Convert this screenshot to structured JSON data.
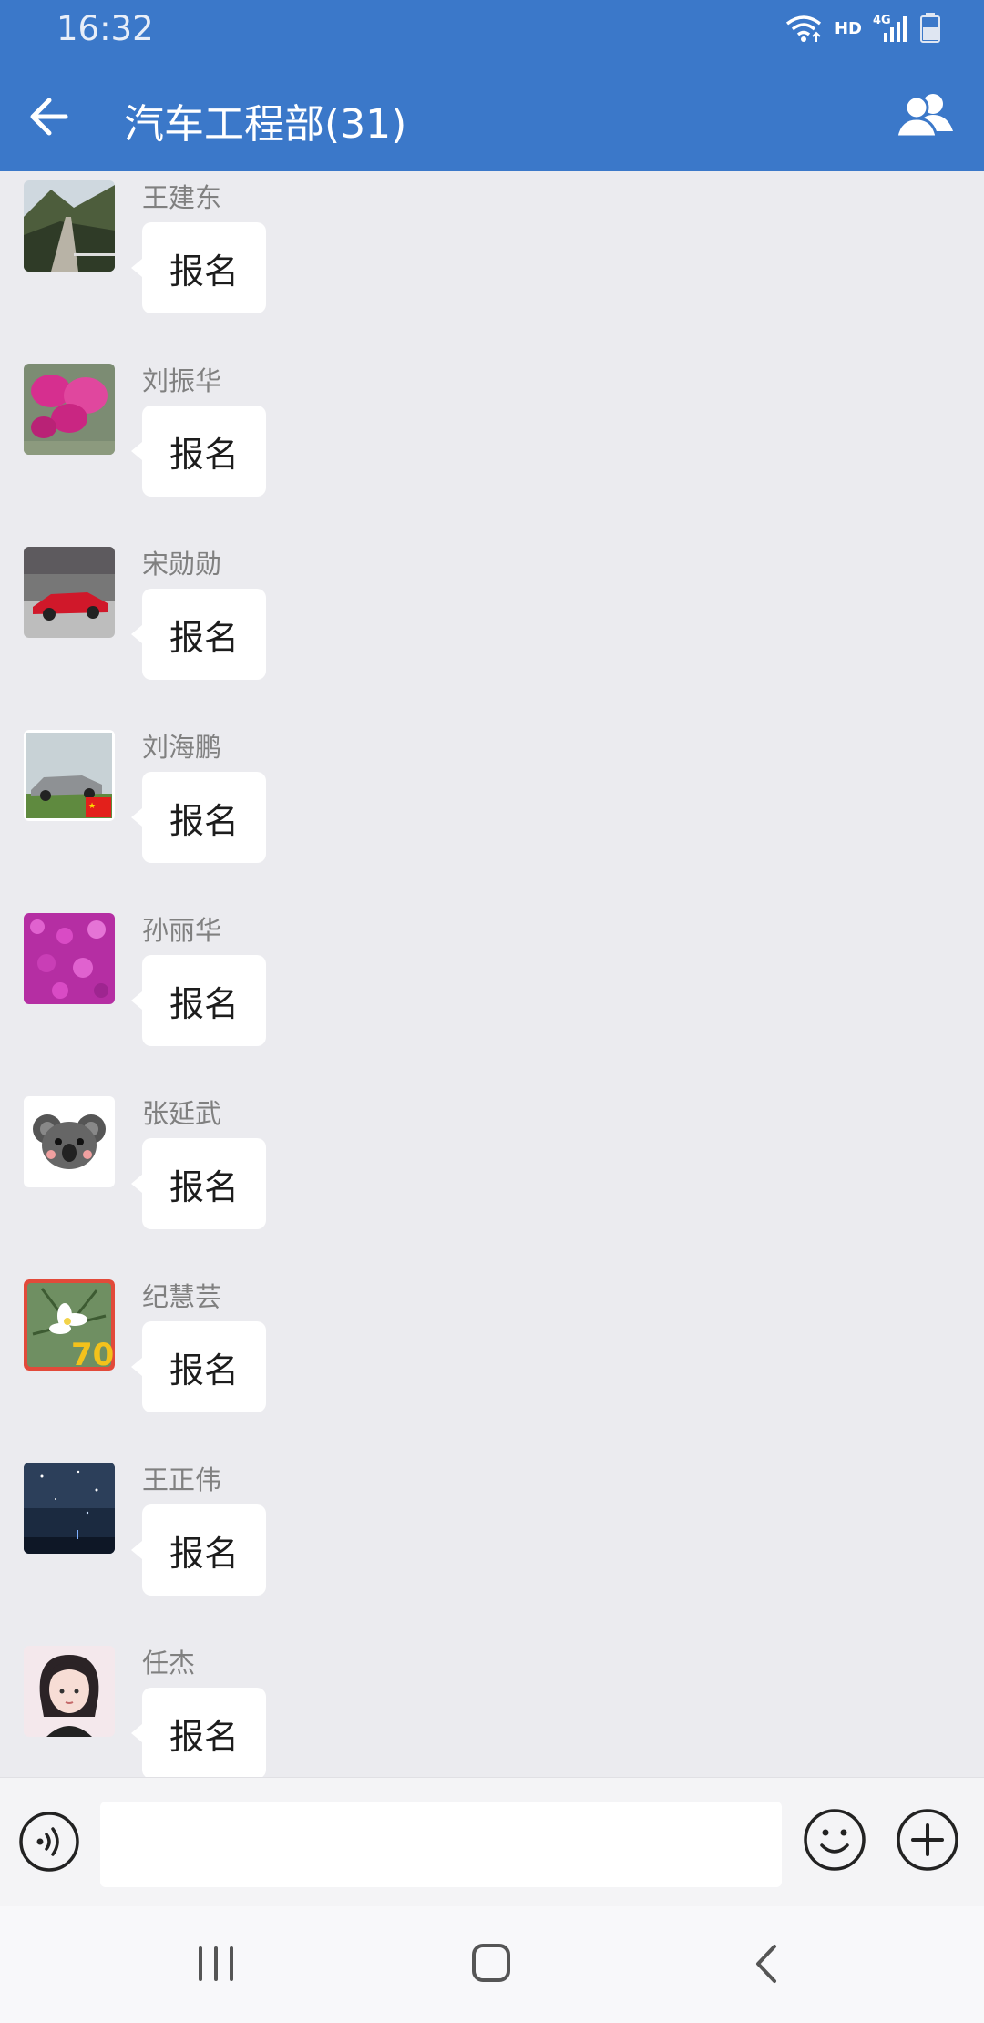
{
  "status_bar": {
    "time": "16:32",
    "hd_label": "HD",
    "network_label": "4G"
  },
  "header": {
    "title": "汽车工程部(31)",
    "back_icon": "arrow-left-icon",
    "members_icon": "group-members-icon"
  },
  "messages": [
    {
      "sender": "王建东",
      "text": "报名",
      "avatar": "mountain-path-photo"
    },
    {
      "sender": "刘振华",
      "text": "报名",
      "avatar": "pink-flowers-photo"
    },
    {
      "sender": "宋勋勋",
      "text": "报名",
      "avatar": "red-sports-car-photo"
    },
    {
      "sender": "刘海鹏",
      "text": "报名",
      "avatar": "silver-suv-photo-with-flag"
    },
    {
      "sender": "孙丽华",
      "text": "报名",
      "avatar": "magenta-flower-field-photo"
    },
    {
      "sender": "张延武",
      "text": "报名",
      "avatar": "koala-cartoon"
    },
    {
      "sender": "纪慧芸",
      "text": "报名",
      "avatar": "white-flower-70-badge"
    },
    {
      "sender": "王正伟",
      "text": "报名",
      "avatar": "starry-night-photo"
    },
    {
      "sender": "任杰",
      "text": "报名",
      "avatar": "anime-girl-portrait"
    }
  ],
  "input_bar": {
    "placeholder": "",
    "voice_icon": "voice-icon",
    "emoji_icon": "emoji-icon",
    "plus_icon": "plus-circle-icon"
  },
  "nav_bar": {
    "recent_icon": "recent-apps-icon",
    "home_icon": "home-icon",
    "back_icon": "back-chevron-icon"
  },
  "colors": {
    "header": "#3b78c9",
    "background": "#ebebef",
    "bubble": "#ffffff"
  }
}
